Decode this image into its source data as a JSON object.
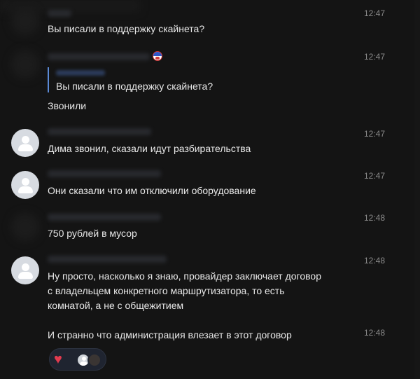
{
  "messages": [
    {
      "id": "m1",
      "time": "12:47",
      "text": "Вы писали в поддержку скайнета?"
    },
    {
      "id": "m2",
      "time": "12:47",
      "quote": "Вы писали в поддержку скайнета?",
      "text": "Звонили"
    },
    {
      "id": "m3",
      "time": "12:47",
      "text": "Дима звонил, сказали идут разбирательства"
    },
    {
      "id": "m4",
      "time": "12:47",
      "text": "Они сказали что им отключили оборудование"
    },
    {
      "id": "m5",
      "time": "12:48",
      "text": "750 рублей в мусор"
    },
    {
      "id": "m6",
      "time": "12:48",
      "lines": [
        "Ну просто, насколько я знаю,  провайдер заключает договор",
        "с владельцем конкретного маршрутизатора, то есть",
        "комнатой, а не с общежитием"
      ]
    },
    {
      "id": "m7",
      "time": "12:48",
      "text": "И странно что администрация влезает в этот договор"
    }
  ],
  "reactions": {
    "emoji": "❤️",
    "icon": "heart-icon"
  },
  "colors": {
    "background": "#141414",
    "text": "#e8e8e8",
    "time": "#8a8a8a",
    "quote_bar": "#5b8ad6",
    "reaction_bg": "#1f2430",
    "heart": "#e23b4f"
  }
}
